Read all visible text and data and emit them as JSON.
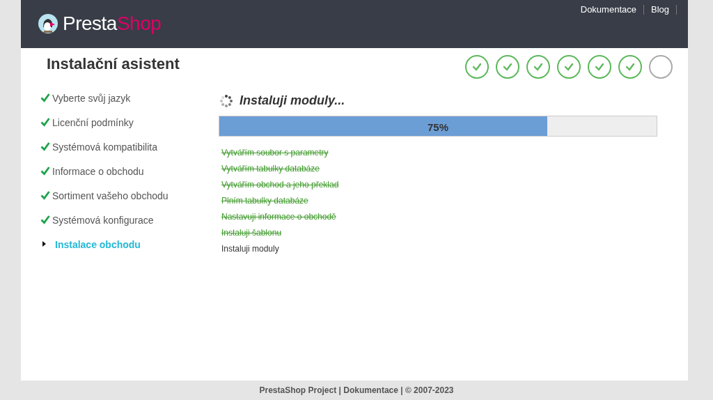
{
  "header": {
    "logo": {
      "text_1": "Presta",
      "text_2": "Shop"
    },
    "links": [
      "Dokumentace",
      "Blog"
    ]
  },
  "title": "Instalační asistent",
  "progress_steps": [
    {
      "done": true
    },
    {
      "done": true
    },
    {
      "done": true
    },
    {
      "done": true
    },
    {
      "done": true
    },
    {
      "done": true
    },
    {
      "done": false
    }
  ],
  "sidebar": {
    "items": [
      {
        "label": "Vyberte svůj jazyk",
        "done": true,
        "selected": false
      },
      {
        "label": "Licenční podmínky",
        "done": true,
        "selected": false
      },
      {
        "label": "Systémová kompatibilita",
        "done": true,
        "selected": false
      },
      {
        "label": "Informace o obchodu",
        "done": true,
        "selected": false
      },
      {
        "label": "Sortiment vašeho obchodu",
        "done": true,
        "selected": false
      },
      {
        "label": "Systémová konfigurace",
        "done": true,
        "selected": false
      },
      {
        "label": "Instalace obchodu",
        "done": false,
        "selected": true
      }
    ]
  },
  "install": {
    "heading": "Instaluji moduly...",
    "progress": {
      "level": 0.75,
      "reading": "75%"
    },
    "tasks": [
      {
        "label": "Vytvářím soubor s parametry",
        "done": true
      },
      {
        "label": "Vytvářím tabulky databáze",
        "done": true
      },
      {
        "label": "Vytvářím obchod a jeho překlad",
        "done": true
      },
      {
        "label": "Plním tabulky databáze",
        "done": true
      },
      {
        "label": "Nastavuji informace o obchodě",
        "done": true
      },
      {
        "label": "Instaluji šablonu",
        "done": true
      },
      {
        "label": "Instaluji moduly",
        "done": false
      }
    ]
  },
  "footer": "PrestaShop Project | Dokumentace | © 2007-2023"
}
